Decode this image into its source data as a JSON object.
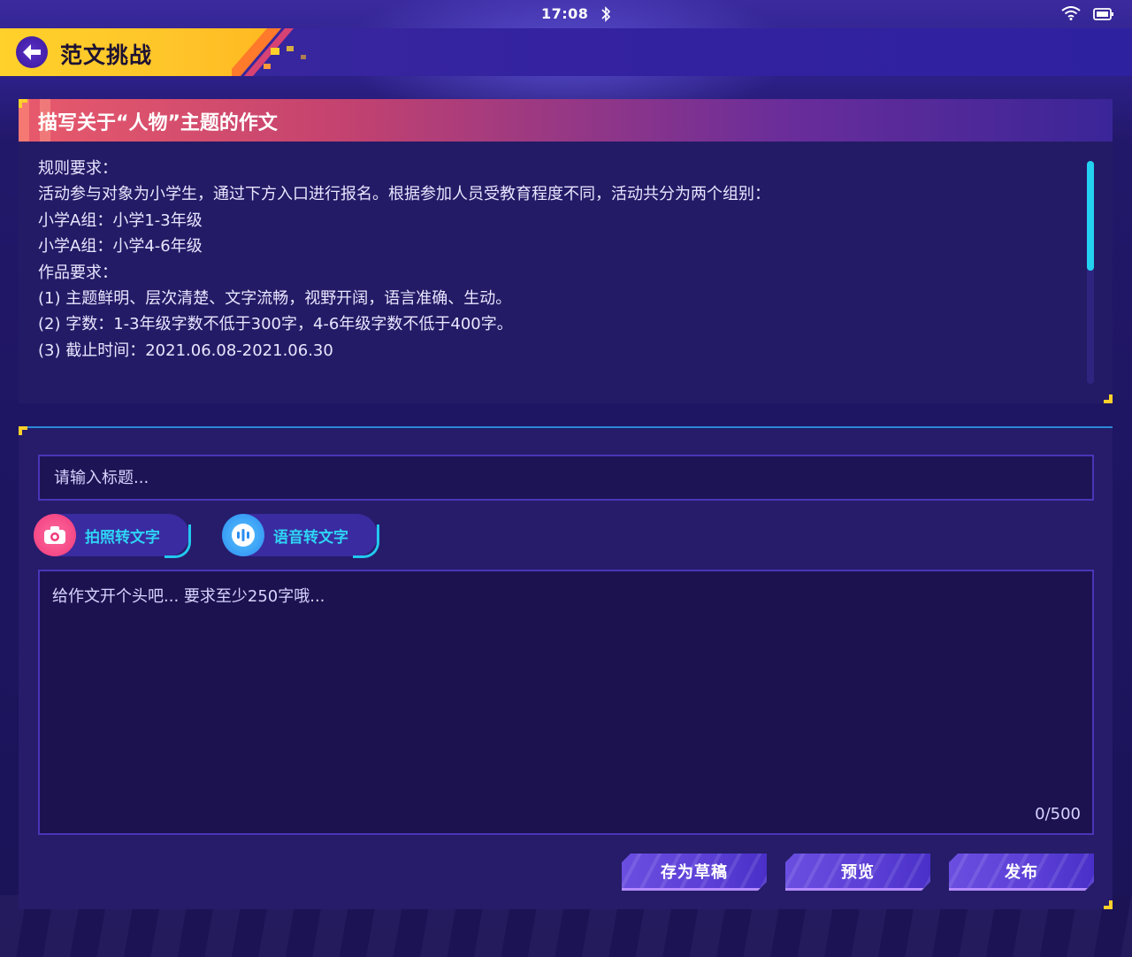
{
  "status_bar": {
    "time": "17:08",
    "bluetooth_icon": "bluetooth-icon",
    "wifi_icon": "wifi-icon",
    "battery_icon": "battery-icon"
  },
  "header": {
    "back_icon": "back-arrow-icon",
    "title": "范文挑战"
  },
  "rules": {
    "title": "描写关于“人物”主题的作文",
    "lines": [
      "规则要求：",
      "活动参与对象为小学生，通过下方入口进行报名。根据参加人员受教育程度不同，活动共分为两个组别：",
      "小学A组：小学1-3年级",
      "小学A组：小学4-6年级",
      "作品要求：",
      "(1) 主题鲜明、层次清楚、文字流畅，视野开阔，语言准确、生动。",
      "(2) 字数：1-3年级字数不低于300字，4-6年级字数不低于400字。",
      "(3) 截止时间：2021.06.08-2021.06.30"
    ]
  },
  "editor": {
    "title_placeholder": "请输入标题...",
    "photo_button": {
      "label": "拍照转文字",
      "icon": "camera-icon"
    },
    "voice_button": {
      "label": "语音转文字",
      "icon": "microphone-icon"
    },
    "content_placeholder": "给作文开个头吧... 要求至少250字哦...",
    "char_count": "0/500"
  },
  "actions": {
    "save_draft": "存为草稿",
    "preview": "预览",
    "publish": "发布"
  },
  "colors": {
    "accent_yellow": "#ffd12a",
    "accent_cyan": "#22d2f0",
    "panel": "#241b66",
    "button_purple": "#5b3fd6"
  }
}
